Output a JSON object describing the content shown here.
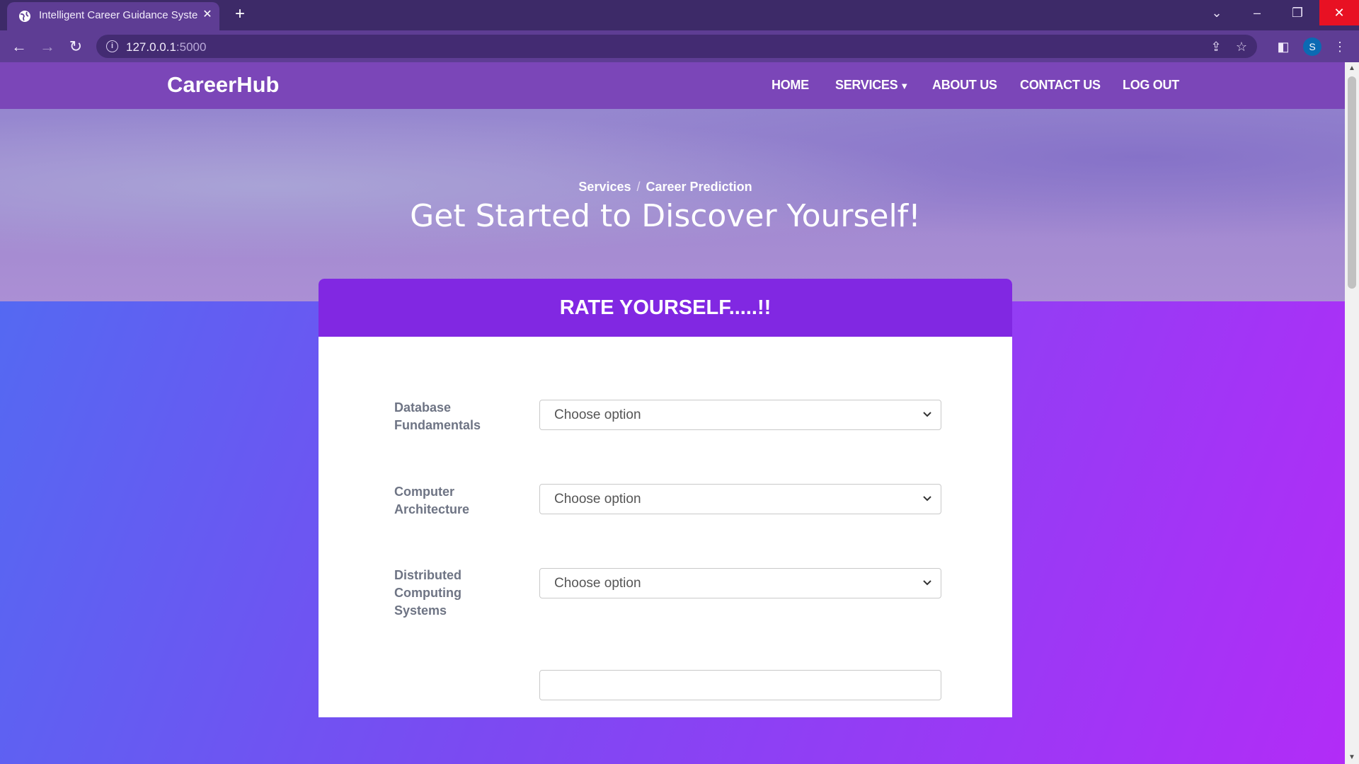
{
  "browser": {
    "tab_title": "Intelligent Career Guidance Syste",
    "url_host": "127.0.0.1",
    "url_port": ":5000",
    "profile_initial": "S"
  },
  "site": {
    "brand": "CareerHub",
    "nav": {
      "home": "HOME",
      "services": "SERVICES",
      "about": "ABOUT US",
      "contact": "CONTACT US",
      "logout": "LOG OUT"
    }
  },
  "hero": {
    "breadcrumb": [
      "Services",
      "Career Prediction"
    ],
    "breadcrumb_sep": "/",
    "title": "Get Started to Discover Yourself!"
  },
  "form": {
    "title": "RATE YOURSELF.....!!",
    "fields": [
      {
        "label": "Database Fundamentals",
        "value": "Choose option"
      },
      {
        "label": "Computer Architecture",
        "value": "Choose option"
      },
      {
        "label": "Distributed Computing Systems",
        "value": "Choose option"
      }
    ]
  }
}
